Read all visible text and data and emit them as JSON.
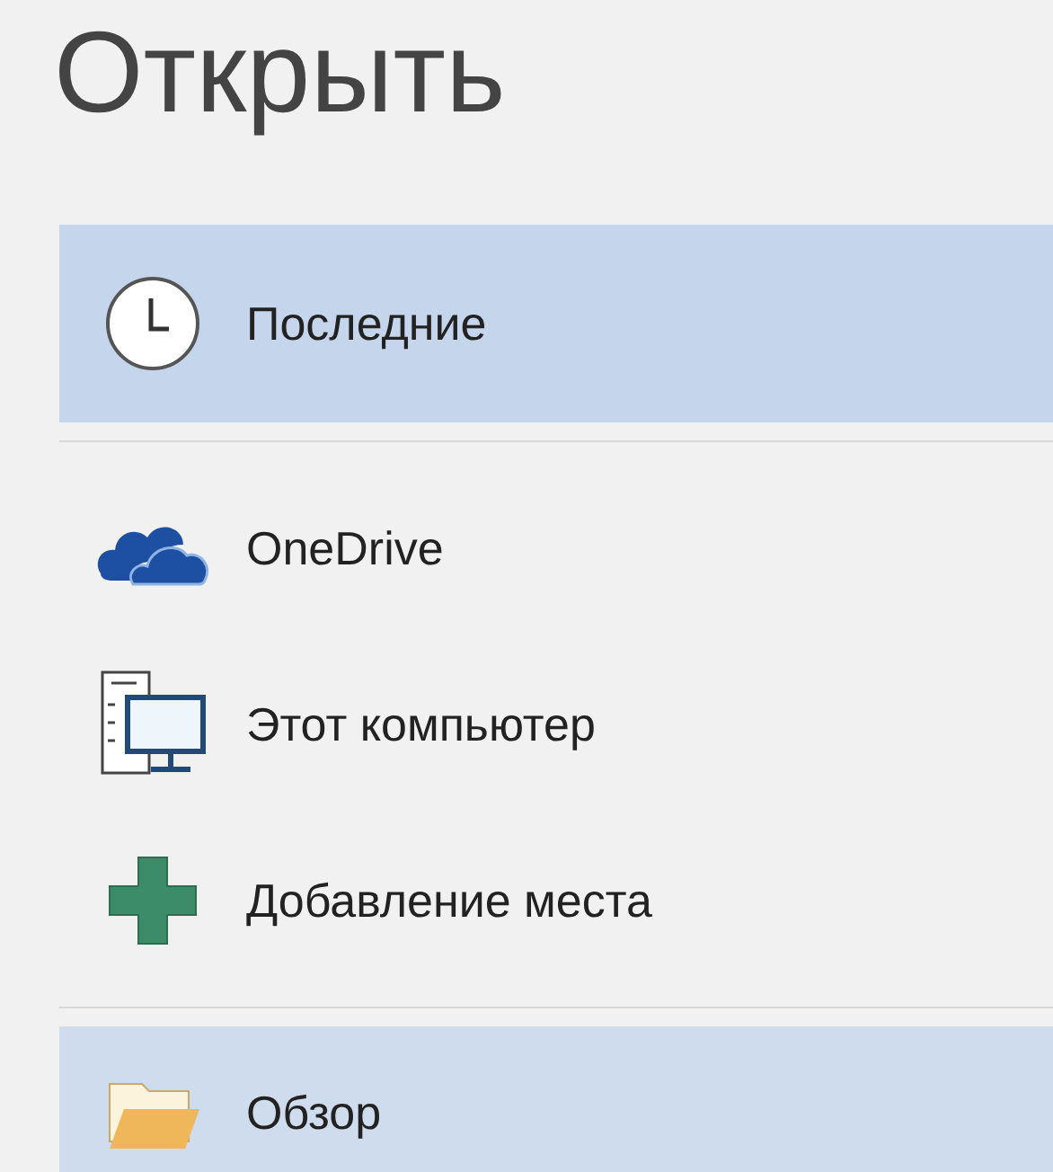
{
  "title": "Открыть",
  "groups": [
    {
      "items": [
        {
          "kind": "recent",
          "label": "Последние",
          "selected": true,
          "hovered": false
        }
      ]
    },
    {
      "items": [
        {
          "kind": "cloud",
          "label": "OneDrive",
          "selected": false,
          "hovered": false
        },
        {
          "kind": "computer",
          "label": "Этот компьютер",
          "selected": false,
          "hovered": false
        },
        {
          "kind": "add",
          "label": "Добавление места",
          "selected": false,
          "hovered": false
        }
      ]
    },
    {
      "items": [
        {
          "kind": "folder",
          "label": "Обзор",
          "selected": false,
          "hovered": true
        }
      ]
    }
  ]
}
